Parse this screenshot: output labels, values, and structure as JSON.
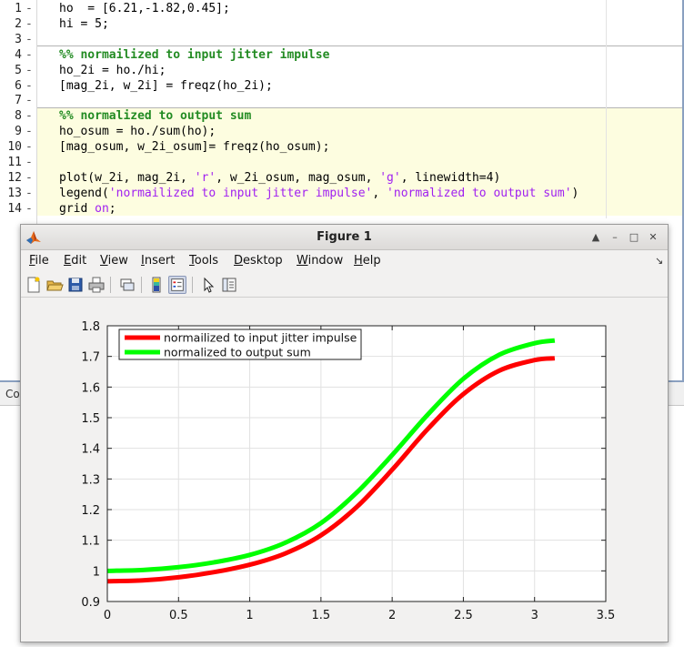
{
  "editor": {
    "lines": [
      {
        "no": "1",
        "tokens": [
          {
            "t": "ho  = [6.21,-1.82,0.45];",
            "c": "code"
          }
        ]
      },
      {
        "no": "2",
        "tokens": [
          {
            "t": "hi = 5;",
            "c": "code"
          }
        ]
      },
      {
        "no": "3",
        "tokens": []
      },
      {
        "no": "4",
        "tokens": [
          {
            "t": "%% normailized to input jitter impulse",
            "c": "comment"
          }
        ]
      },
      {
        "no": "5",
        "tokens": [
          {
            "t": "ho_2i = ho./hi;",
            "c": "code"
          }
        ]
      },
      {
        "no": "6",
        "tokens": [
          {
            "t": "[mag_2i, w_2i] = freqz(ho_2i);",
            "c": "code"
          }
        ]
      },
      {
        "no": "7",
        "tokens": []
      },
      {
        "no": "8",
        "tokens": [
          {
            "t": "%% normalized to output sum",
            "c": "comment"
          }
        ]
      },
      {
        "no": "9",
        "tokens": [
          {
            "t": "ho_osum = ho./sum(ho);",
            "c": "code"
          }
        ]
      },
      {
        "no": "10",
        "tokens": [
          {
            "t": "[mag_osum, w_2i_osum]= freqz(ho_osum);",
            "c": "code"
          }
        ]
      },
      {
        "no": "11",
        "tokens": []
      },
      {
        "no": "12",
        "tokens": [
          {
            "t": "plot(w_2i, mag_2i, ",
            "c": "code"
          },
          {
            "t": "'r'",
            "c": "string"
          },
          {
            "t": ", w_2i_osum, mag_osum, ",
            "c": "code"
          },
          {
            "t": "'g'",
            "c": "string"
          },
          {
            "t": ", linewidth=4)",
            "c": "code"
          }
        ]
      },
      {
        "no": "13",
        "tokens": [
          {
            "t": "legend(",
            "c": "code"
          },
          {
            "t": "'normailized to input jitter impulse'",
            "c": "string"
          },
          {
            "t": ", ",
            "c": "code"
          },
          {
            "t": "'normalized to output sum'",
            "c": "string"
          },
          {
            "t": ")",
            "c": "code"
          }
        ]
      },
      {
        "no": "14",
        "tokens": [
          {
            "t": "grid ",
            "c": "code"
          },
          {
            "t": "on",
            "c": "keyword"
          },
          {
            "t": ";",
            "c": "code"
          }
        ]
      }
    ]
  },
  "command_window": {
    "label": "Co"
  },
  "figure": {
    "title": "Figure 1",
    "menu": [
      {
        "label": "File",
        "ul": "F",
        "rest": "ile"
      },
      {
        "label": "Edit",
        "ul": "E",
        "rest": "dit"
      },
      {
        "label": "View",
        "ul": "V",
        "rest": "iew"
      },
      {
        "label": "Insert",
        "ul": "I",
        "rest": "nsert"
      },
      {
        "label": "Tools",
        "ul": "T",
        "rest": "ools"
      },
      {
        "label": "Desktop",
        "ul": "D",
        "rest": "esktop"
      },
      {
        "label": "Window",
        "ul": "W",
        "rest": "indow"
      },
      {
        "label": "Help",
        "ul": "H",
        "rest": "elp"
      }
    ],
    "menu_overflow": "↘",
    "window_buttons": [
      "▲",
      "–",
      "□",
      "✕"
    ],
    "toolbar_icons": [
      "new-figure-icon",
      "open-file-icon",
      "save-icon",
      "print-icon",
      "link-plot-icon",
      "insert-colorbar-icon",
      "insert-legend-icon",
      "edit-plot-icon",
      "property-inspector-icon"
    ]
  },
  "chart_data": {
    "type": "line",
    "xlim": [
      0,
      3.5
    ],
    "ylim": [
      0.9,
      1.8
    ],
    "xticks": [
      "0",
      "0.5",
      "1",
      "1.5",
      "2",
      "2.5",
      "3",
      "3.5"
    ],
    "yticks": [
      "0.9",
      "1",
      "1.1",
      "1.2",
      "1.3",
      "1.4",
      "1.5",
      "1.6",
      "1.7",
      "1.8"
    ],
    "grid": true,
    "legend_position": "top-left",
    "series": [
      {
        "name": "normailized to input jitter impulse",
        "color": "#ff0000",
        "x": [
          0,
          0.25,
          0.5,
          0.75,
          1.0,
          1.25,
          1.5,
          1.75,
          2.0,
          2.25,
          2.5,
          2.75,
          3.0,
          3.1416
        ],
        "y": [
          0.966,
          0.969,
          0.979,
          0.996,
          1.02,
          1.057,
          1.116,
          1.208,
          1.33,
          1.463,
          1.577,
          1.653,
          1.688,
          1.694
        ]
      },
      {
        "name": "normalized to output sum",
        "color": "#00ff00",
        "x": [
          0,
          0.25,
          0.5,
          0.75,
          1.0,
          1.25,
          1.5,
          1.75,
          2.0,
          2.25,
          2.5,
          2.75,
          3.0,
          3.1416
        ],
        "y": [
          1.0,
          1.003,
          1.012,
          1.028,
          1.052,
          1.092,
          1.156,
          1.255,
          1.378,
          1.51,
          1.627,
          1.705,
          1.743,
          1.752
        ]
      }
    ]
  }
}
